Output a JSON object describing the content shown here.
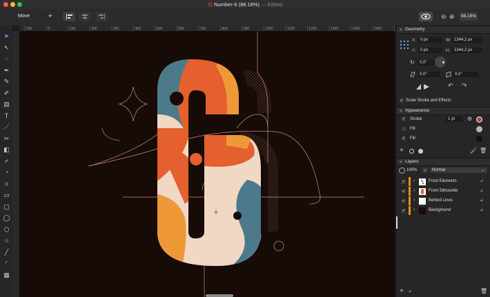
{
  "window": {
    "title": "Number-6 (88.18%)",
    "edited": "— Edited",
    "traffic_colors": [
      "#fe5f57",
      "#febc2e",
      "#28c840"
    ]
  },
  "toolbar": {
    "tool_name": "Move",
    "zoom": "88,18%"
  },
  "ruler": {
    "ticks": [
      "100",
      "0",
      "100",
      "200",
      "300",
      "400",
      "500",
      "600",
      "700",
      "800",
      "900",
      "1000",
      "1100",
      "1200",
      "1300",
      "1400",
      "1500",
      "1600"
    ]
  },
  "geometry": {
    "title": "Geometry",
    "x_label": "X:",
    "x_value": "0 px",
    "y_label": "Y:",
    "y_value": "0 px",
    "w_label": "W:",
    "w_value": "1344,2 px",
    "h_label": "H:",
    "h_value": "1344,2 px",
    "rotation": "0,0°",
    "shear_x": "0,0°",
    "shear_y": "0,0°",
    "scale_stroke": "Scale Stroke and Effects"
  },
  "appearance": {
    "title": "Appearance",
    "rows": [
      {
        "label": "Stroke",
        "value": "1 pt",
        "checked": true,
        "swatch": "#f1aaa0"
      },
      {
        "label": "Fill",
        "value": "",
        "checked": false,
        "swatch": "#b5b5b5"
      },
      {
        "label": "Fill",
        "value": "",
        "checked": true,
        "swatch": "#1a0c07"
      }
    ]
  },
  "layers": {
    "title": "Layers",
    "opacity": "100%",
    "blend": "Normal",
    "items": [
      {
        "name": "Front Elements",
        "visible": true
      },
      {
        "name": "Front Silhouette",
        "visible": true
      },
      {
        "name": "Behind Lines",
        "visible": true
      },
      {
        "name": "Background",
        "visible": true
      }
    ]
  },
  "colors": {
    "orange": "#e4602f",
    "amber": "#ef9838",
    "teal": "#4d7a8b",
    "cream": "#f1d8c4",
    "line": "#c98f7d",
    "canvas_bg": "#170b07"
  }
}
